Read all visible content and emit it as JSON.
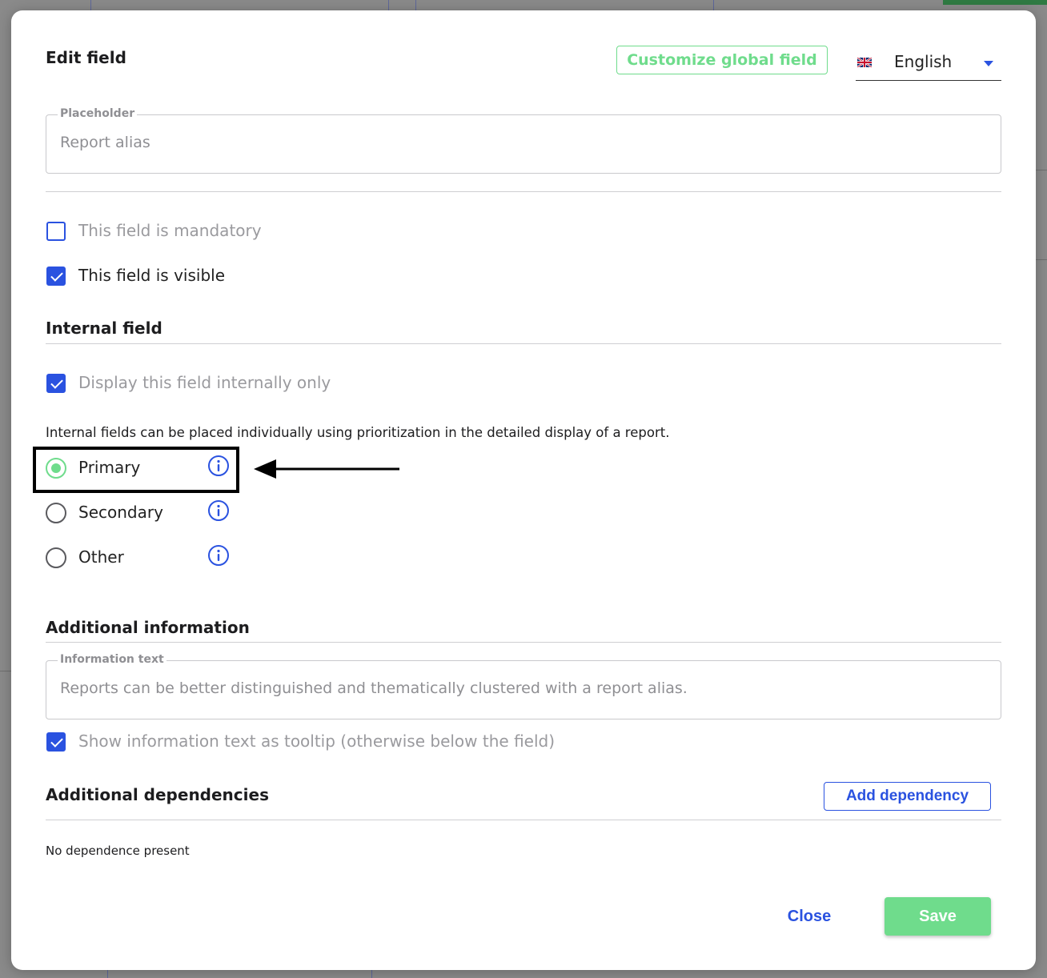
{
  "dialog": {
    "title": "Edit field",
    "customize_label": "Customize global field",
    "language": {
      "selected": "English",
      "icon": "uk-flag-icon"
    }
  },
  "placeholder_field": {
    "legend": "Placeholder",
    "value": "Report alias"
  },
  "options": {
    "mandatory_label": "This field is mandatory",
    "mandatory_checked": false,
    "visible_label": "This field is visible",
    "visible_checked": true
  },
  "internal": {
    "title": "Internal field",
    "internal_only_label": "Display this field internally only",
    "internal_only_checked": true,
    "note": "Internal fields can be placed individually using prioritization in the detailed display of a report.",
    "priorities": [
      {
        "label": "Primary",
        "selected": true
      },
      {
        "label": "Secondary",
        "selected": false
      },
      {
        "label": "Other",
        "selected": false
      }
    ]
  },
  "additional_info": {
    "title": "Additional information",
    "legend": "Information text",
    "value": "Reports can be better distinguished and thematically clustered with a report alias.",
    "tooltip_label": "Show information text as tooltip (otherwise below the field)",
    "tooltip_checked": true
  },
  "dependencies": {
    "title": "Additional dependencies",
    "add_label": "Add dependency",
    "empty_text": "No dependence present"
  },
  "footer": {
    "close_label": "Close",
    "save_label": "Save"
  },
  "colors": {
    "accent_blue": "#2a52e0",
    "accent_green": "#6fdc8c",
    "muted_text": "#9a9a9e"
  }
}
